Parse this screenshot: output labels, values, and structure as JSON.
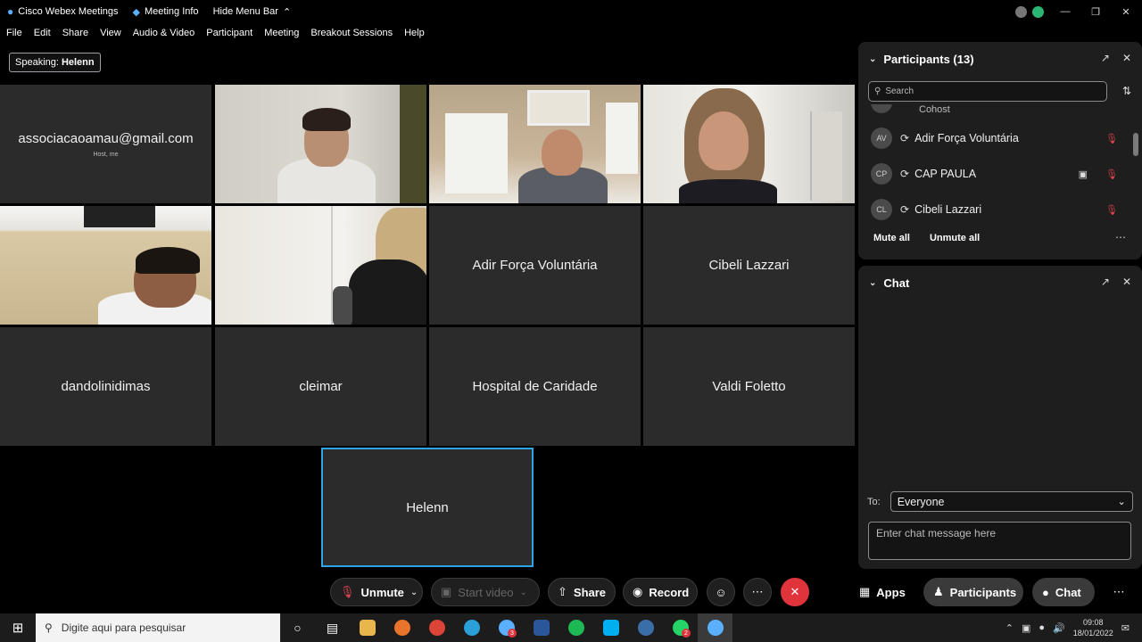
{
  "titlebar": {
    "app_title": "Cisco Webex Meetings",
    "meeting_info": "Meeting Info",
    "hide_menu": "Hide Menu Bar"
  },
  "menu": [
    "File",
    "Edit",
    "Share",
    "View",
    "Audio & Video",
    "Participant",
    "Meeting",
    "Breakout Sessions",
    "Help"
  ],
  "speaking": {
    "label": "Speaking:",
    "name": "Helenn"
  },
  "tiles": {
    "host_email": "associacaoamau@gmail.com",
    "host_sub": "Host, me",
    "t1": "Adir Força Voluntária",
    "t2": "Cibeli Lazzari",
    "t3": "dandolinidimas",
    "t4": "cleimar",
    "t5": "Hospital de Caridade",
    "t6": "Valdi Foletto",
    "active": "Helenn"
  },
  "participants": {
    "title": "Participants (13)",
    "search_placeholder": "Search",
    "cohost_label": "Cohost",
    "rows": [
      {
        "initials": "AV",
        "name": "Adir Força Voluntária"
      },
      {
        "initials": "CP",
        "name": "CAP PAULA"
      },
      {
        "initials": "CL",
        "name": "Cibeli Lazzari"
      }
    ],
    "mute_all": "Mute all",
    "unmute_all": "Unmute all"
  },
  "chat": {
    "title": "Chat",
    "to_label": "To:",
    "to_value": "Everyone",
    "input_placeholder": "Enter chat message here"
  },
  "controls": {
    "unmute": "Unmute",
    "start_video": "Start video",
    "share": "Share",
    "record": "Record",
    "apps": "Apps",
    "participants": "Participants",
    "chat": "Chat"
  },
  "taskbar": {
    "search_placeholder": "Digite aqui para pesquisar",
    "time": "09:08",
    "date": "18/01/2022",
    "badge_a": "3",
    "badge_b": "2"
  },
  "colors": {
    "accent": "#2ea6e6",
    "end_call": "#e0343c",
    "muted": "#e0444e"
  }
}
